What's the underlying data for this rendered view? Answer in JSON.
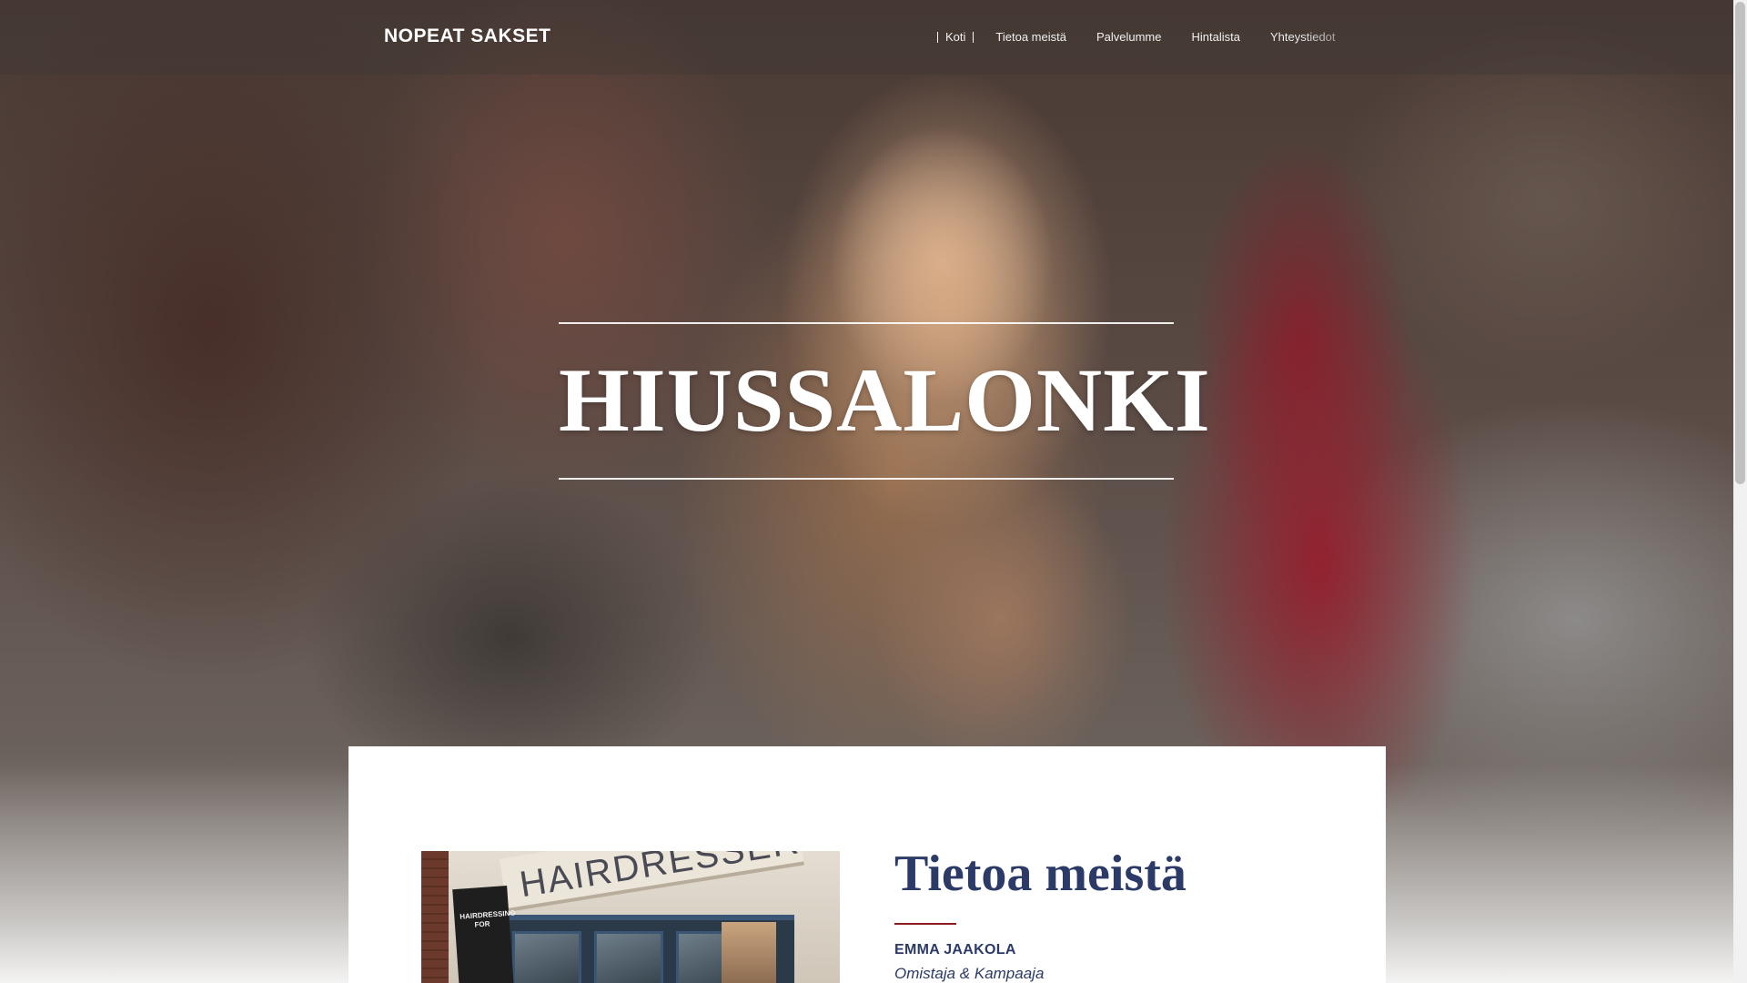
{
  "brand": "NOPEAT SAKSET",
  "nav": {
    "items": [
      {
        "label": "Koti",
        "active": true
      },
      {
        "label": "Tietoa meistä",
        "active": false
      },
      {
        "label": "Palvelumme",
        "active": false
      },
      {
        "label": "Hintalista",
        "active": false
      },
      {
        "label": "Yhteystiedot",
        "active": false
      }
    ]
  },
  "hero": {
    "title": "HIUSSALONKI"
  },
  "about": {
    "image_sign_text": "HAIRDRESSER",
    "image_board_text": "HAIRDRESSING FOR",
    "heading": "Tietoa meistä",
    "person_name": "EMMA JAAKOLA",
    "person_role": "Omistaja & Kampaaja"
  },
  "colors": {
    "heading": "#2b3a67",
    "accent_rule": "#8b1d22",
    "nav_text": "#f0f0f0"
  }
}
